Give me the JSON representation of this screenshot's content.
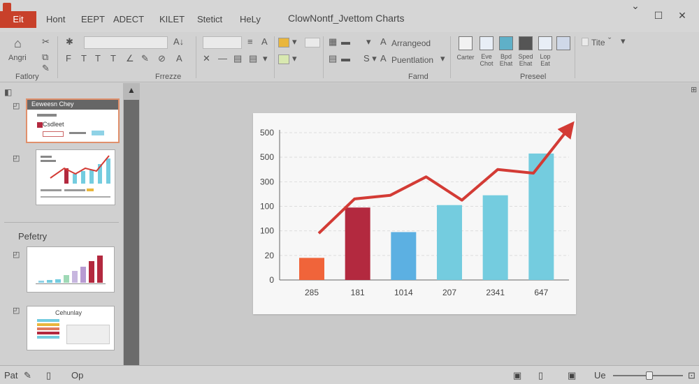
{
  "titlebar": {
    "file_label": "Eit",
    "menus": [
      "Hont",
      "EEPT",
      "ADECT",
      "KILET",
      "Stetict",
      "HeLy"
    ],
    "doc_title": "ClowNontf_Jvettom Charts",
    "controls": [
      "⌄",
      "☐",
      "✕"
    ]
  },
  "ribbon": {
    "labels": {
      "angri": "Angri",
      "arrangeo": "Arrangeod",
      "puentlation": "Puentlation",
      "tite": "Tite",
      "carter": "Carter"
    },
    "group_labels": [
      "Fatlory",
      "Frrezze",
      "Farnd",
      "Preseel"
    ],
    "tile_labels": [
      "Carter",
      "Eve Chot",
      "Bpd Ehat",
      "Sped Ehat",
      "Lop Eat"
    ]
  },
  "panel": {
    "thumb1": {
      "title": "Eeweesn Chey",
      "row_label": "Csdleet"
    },
    "section_title": "Pefetry",
    "thumb4_title": "Cehunlay"
  },
  "status": {
    "left1": "Pat",
    "left2": "Op",
    "zoom_label": "Ue"
  },
  "chart_data": {
    "type": "bar",
    "categories": [
      "285",
      "181",
      "1014",
      "207",
      "2341",
      "647"
    ],
    "ytick_labels": [
      "0",
      "20",
      "100",
      "100",
      "300",
      "500",
      "500"
    ],
    "ylim": [
      0,
      600
    ],
    "values": [
      90,
      295,
      195,
      305,
      345,
      515
    ],
    "trend_line": [
      190,
      330,
      345,
      420,
      325,
      450,
      435,
      620
    ],
    "colors": {
      "bars": [
        "#f0643a",
        "#b3293f",
        "#5cb0e2",
        "#74ccdf",
        "#74ccdf",
        "#74ccdf"
      ],
      "trend": "#d33b35"
    }
  }
}
